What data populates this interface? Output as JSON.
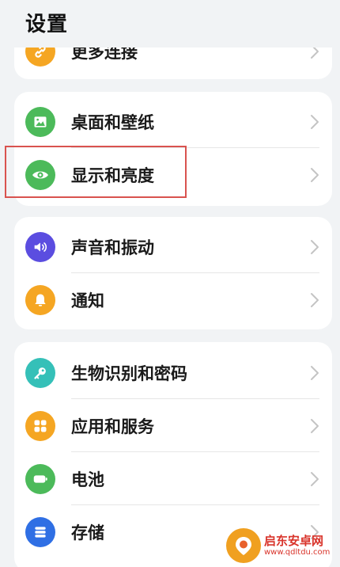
{
  "header": {
    "title": "设置"
  },
  "groups": [
    {
      "items": [
        {
          "label": "更多连接",
          "icon": "link-icon",
          "color": "#f5a623"
        }
      ]
    },
    {
      "items": [
        {
          "label": "桌面和壁纸",
          "icon": "wallpaper-icon",
          "color": "#4cba5a"
        },
        {
          "label": "显示和亮度",
          "icon": "eye-icon",
          "color": "#4cba5a"
        }
      ]
    },
    {
      "items": [
        {
          "label": "声音和振动",
          "icon": "speaker-icon",
          "color": "#5b4de0"
        },
        {
          "label": "通知",
          "icon": "bell-icon",
          "color": "#f5a623"
        }
      ]
    },
    {
      "items": [
        {
          "label": "生物识别和密码",
          "icon": "key-icon",
          "color": "#35c0b8"
        },
        {
          "label": "应用和服务",
          "icon": "apps-grid-icon",
          "color": "#f5a623"
        },
        {
          "label": "电池",
          "icon": "battery-icon",
          "color": "#4cba5a"
        },
        {
          "label": "存储",
          "icon": "storage-icon",
          "color": "#2f6fe4"
        }
      ]
    }
  ],
  "highlight": {
    "color": "#d9534f"
  },
  "watermark": {
    "title": "启东安卓网",
    "url": "www.qdltdu.com"
  }
}
